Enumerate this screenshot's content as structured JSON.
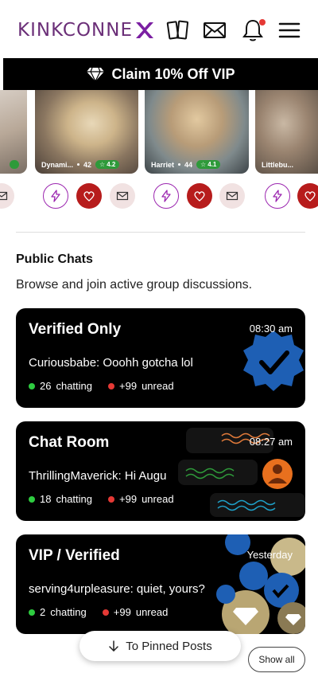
{
  "header": {
    "logo_text": "KINKCONNE",
    "icons": [
      "cards-icon",
      "mail-icon",
      "bell-icon",
      "menu-icon"
    ]
  },
  "vip_banner": {
    "label": "Claim 10% Off VIP"
  },
  "profiles": [
    {
      "name": "Dynami...",
      "age": "42",
      "rating": "4.2"
    },
    {
      "name": "Harriet",
      "age": "44",
      "rating": "4.1"
    },
    {
      "name": "Littlebu...",
      "age": "",
      "rating": ""
    }
  ],
  "public_chats": {
    "title": "Public Chats",
    "subtitle": "Browse and join active group discussions.",
    "rooms": [
      {
        "title": "Verified Only",
        "time": "08:30 am",
        "last_user": "Curiousbabe:",
        "last_msg": "Ooohh gotcha lol",
        "chatting": "26",
        "chatting_label": "chatting",
        "unread": "+99",
        "unread_label": "unread"
      },
      {
        "title": "Chat Room",
        "time": "08:27 am",
        "last_user": "ThrillingMaverick:",
        "last_msg": "Hi Augu",
        "chatting": "18",
        "chatting_label": "chatting",
        "unread": "+99",
        "unread_label": "unread"
      },
      {
        "title": "VIP / Verified",
        "time": "Yesterday",
        "last_user": "serving4urpleasure:",
        "last_msg": "quiet, yours?",
        "chatting": "2",
        "chatting_label": "chatting",
        "unread": "+99",
        "unread_label": "unread"
      }
    ]
  },
  "buttons": {
    "pinned": "To Pinned Posts",
    "show_all": "Show all"
  },
  "colors": {
    "brand_purple": "#6b2f78",
    "accent_purple": "#9c27b0",
    "heart_red": "#b71c1c",
    "online_green": "#2ecc40",
    "unread_red": "#e53935"
  }
}
